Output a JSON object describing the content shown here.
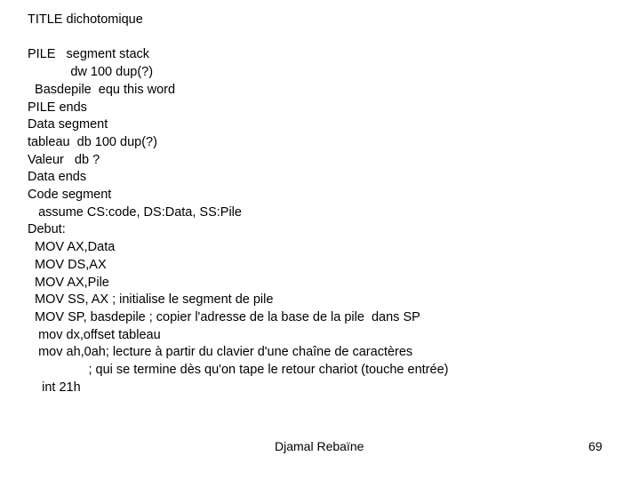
{
  "slide": {
    "background_color": "#ffffff",
    "text_color": "#000000",
    "title_line": "TITLE dichotomique",
    "code_lines": [
      "TITLE dichotomique",
      "",
      "PILE   segment stack",
      "            dw 100 dup(?)",
      "  Basdepile  equ this word",
      "PILE ends",
      "Data segment",
      "tableau  db 100 dup(?)",
      "Valeur   db ?",
      "Data ends",
      "Code segment",
      "   assume CS:code, DS:Data, SS:Pile",
      "Debut:",
      "  MOV AX,Data",
      "  MOV DS,AX",
      "  MOV AX,Pile",
      "  MOV SS, AX ; initialise le segment de pile",
      "  MOV SP, basdepile ; copier l'adresse de la base de la pile  dans SP",
      "   mov dx,offset tableau",
      "   mov ah,0ah; lecture à partir du clavier d'une chaîne de caractères",
      "                 ; qui se termine dès qu'on tape le retour chariot (touche entrée)",
      "    int 21h"
    ]
  },
  "footer": {
    "author": "Djamal Rebaïne",
    "page_number": "69"
  }
}
